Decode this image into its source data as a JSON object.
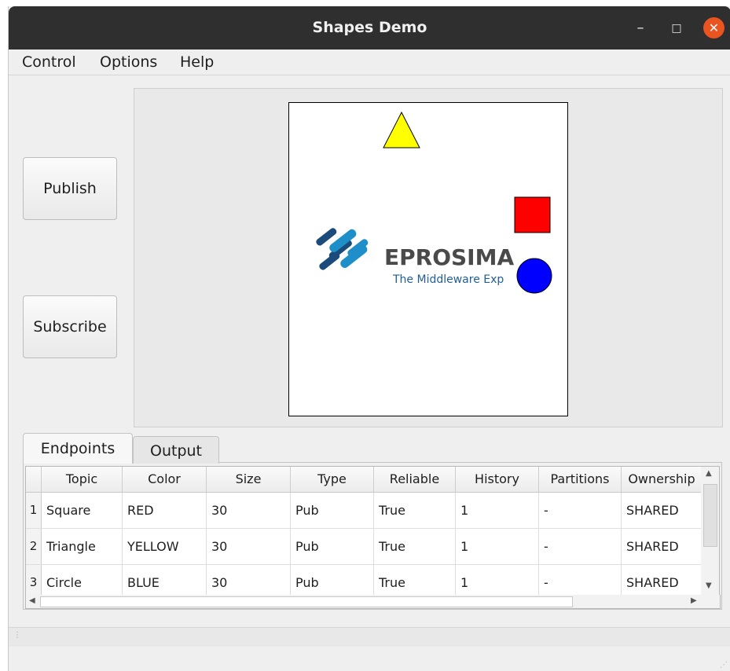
{
  "window": {
    "title": "Shapes Demo",
    "minimize_glyph": "–",
    "maximize_glyph": "□",
    "close_glyph": "✕"
  },
  "menu": [
    "Control",
    "Options",
    "Help"
  ],
  "buttons": {
    "publish": "Publish",
    "subscribe": "Subscribe"
  },
  "canvas": {
    "logo_text": "EPROSIMA",
    "logo_tagline": "The Middleware Exp",
    "shapes": [
      {
        "kind": "triangle",
        "color": "#ffff00"
      },
      {
        "kind": "square",
        "color": "#ff0000"
      },
      {
        "kind": "circle",
        "color": "#0000ff"
      }
    ]
  },
  "tabs": {
    "endpoints": "Endpoints",
    "output": "Output"
  },
  "table": {
    "columns": [
      "Topic",
      "Color",
      "Size",
      "Type",
      "Reliable",
      "History",
      "Partitions",
      "Ownership"
    ],
    "rows": [
      {
        "num": "1",
        "cells": [
          "Square",
          "RED",
          "30",
          "Pub",
          "True",
          "1",
          "-",
          "SHARED"
        ]
      },
      {
        "num": "2",
        "cells": [
          "Triangle",
          "YELLOW",
          "30",
          "Pub",
          "True",
          "1",
          "-",
          "SHARED"
        ]
      },
      {
        "num": "3",
        "cells": [
          "Circle",
          "BLUE",
          "30",
          "Pub",
          "True",
          "1",
          "-",
          "SHARED"
        ]
      }
    ]
  },
  "colors": {
    "titlebar": "#2f2f2f",
    "close_button": "#e95420",
    "logo_blue": "#1f8fc9",
    "logo_navy": "#1a4b7a"
  }
}
